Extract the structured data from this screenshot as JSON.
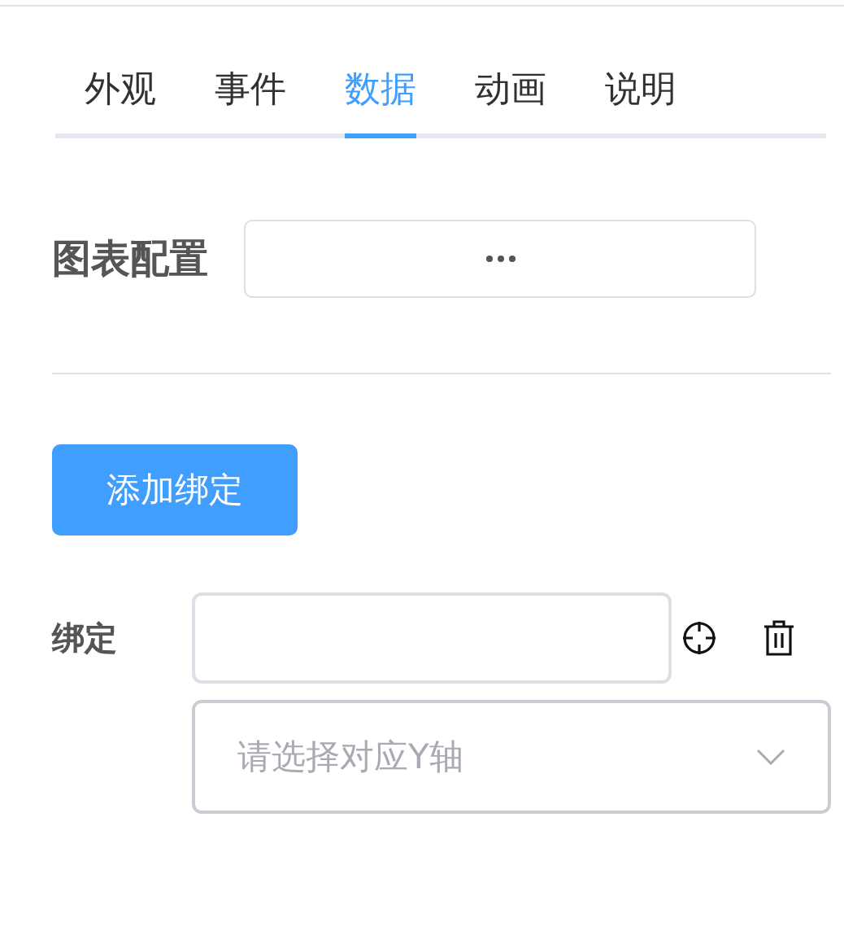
{
  "tabs": [
    {
      "label": "外观",
      "selected": false
    },
    {
      "label": "事件",
      "selected": false
    },
    {
      "label": "数据",
      "selected": true
    },
    {
      "label": "动画",
      "selected": false
    },
    {
      "label": "说明",
      "selected": false
    }
  ],
  "chart_config": {
    "label": "图表配置"
  },
  "add_button": {
    "label": "添加绑定"
  },
  "binding": {
    "label": "绑定",
    "select": {
      "placeholder": "请选择对应Y轴"
    }
  }
}
